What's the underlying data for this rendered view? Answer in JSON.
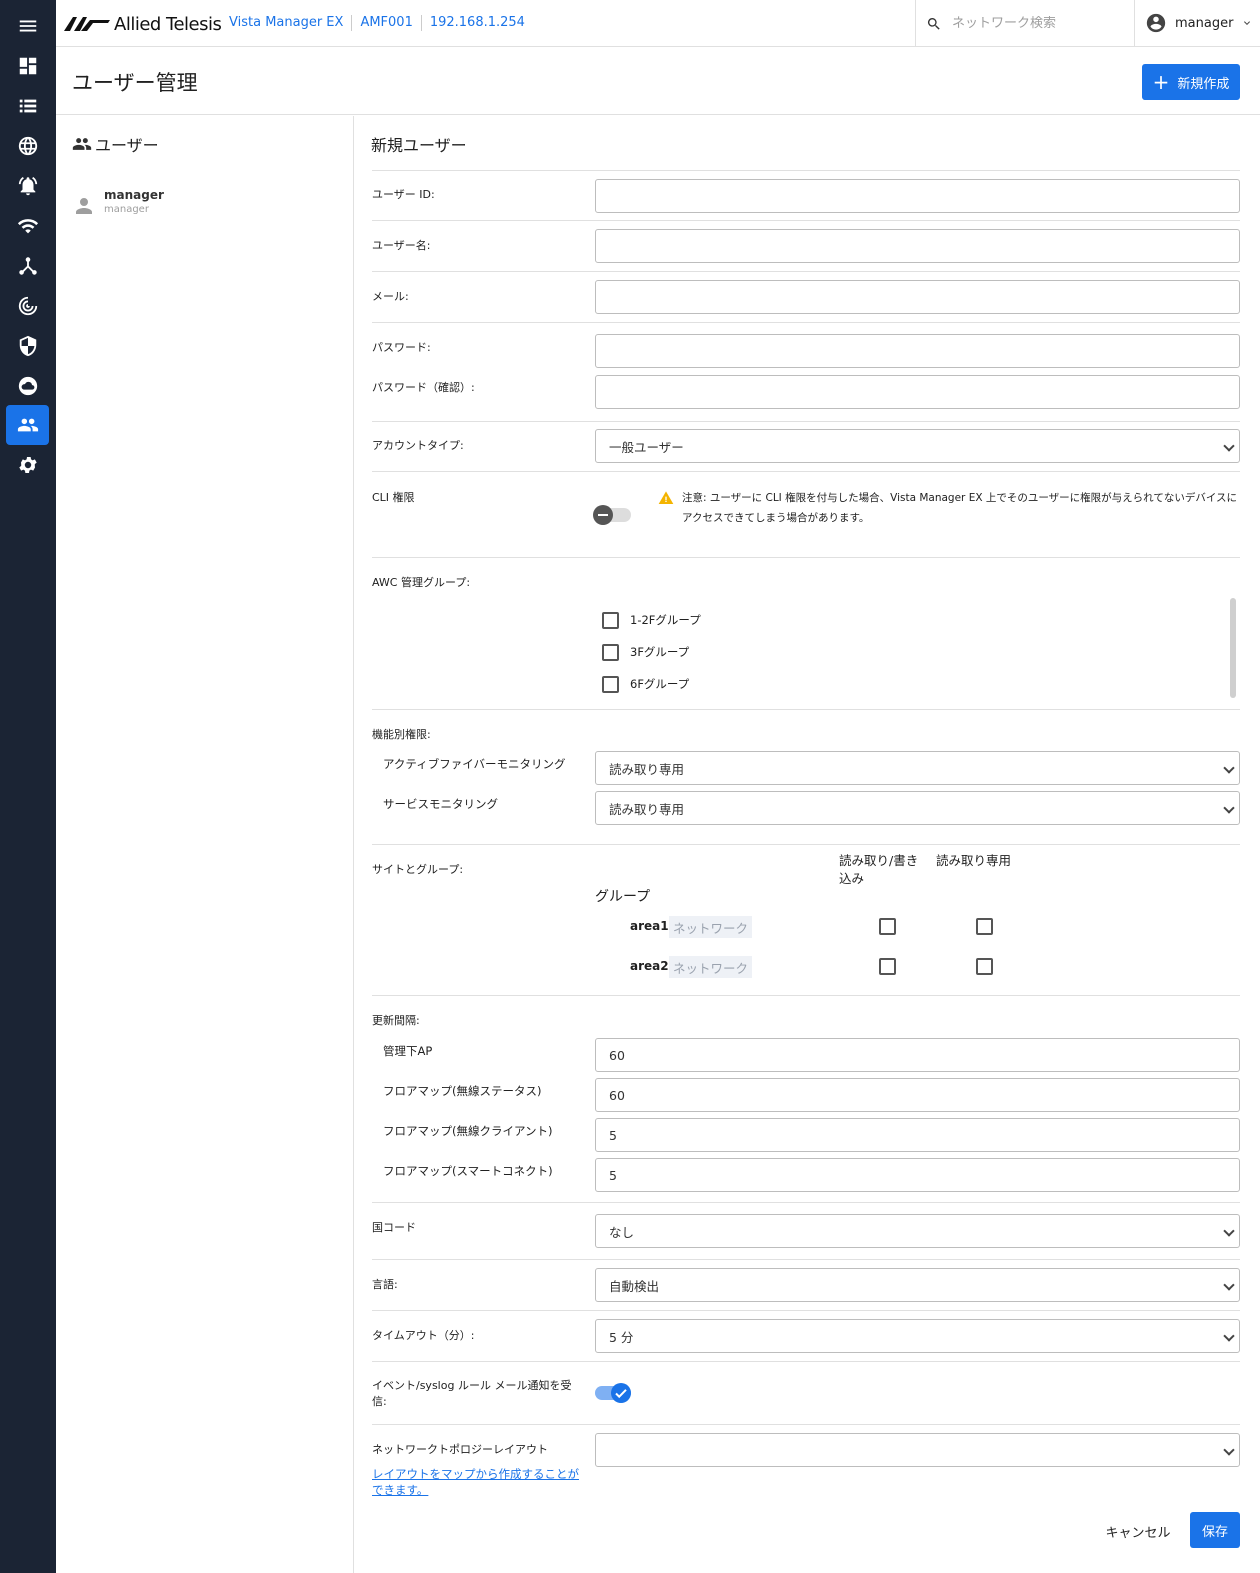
{
  "nav": {
    "items": [
      {
        "icon": "menu-icon"
      },
      {
        "icon": "dashboard-icon"
      },
      {
        "icon": "list-icon"
      },
      {
        "icon": "globe-icon"
      },
      {
        "icon": "alarm-icon"
      },
      {
        "icon": "wifi-icon"
      },
      {
        "icon": "topology-icon"
      },
      {
        "icon": "radar-icon"
      },
      {
        "icon": "shield-icon"
      },
      {
        "icon": "cloud-icon"
      },
      {
        "icon": "users-icon",
        "active": true
      },
      {
        "icon": "settings-icon"
      }
    ]
  },
  "header": {
    "brand": "Allied Telesis",
    "breadcrumbs": [
      "Vista Manager EX",
      "AMF001",
      "192.168.1.254"
    ],
    "search_placeholder": "ネットワーク検索",
    "user": "manager"
  },
  "page": {
    "title": "ユーザー管理",
    "new_button": "新規作成"
  },
  "user_list": {
    "title": "ユーザー",
    "users": [
      {
        "name": "manager",
        "id": "manager"
      }
    ]
  },
  "form": {
    "title": "新規ユーザー",
    "user_id_label": "ユーザー ID:",
    "user_name_label": "ユーザー名:",
    "email_label": "メール:",
    "password_label": "パスワード:",
    "password_confirm_label": "パスワード（確認）:",
    "account_type_label": "アカウントタイプ:",
    "account_type_value": "一般ユーザー",
    "cli_label": "CLI 権限",
    "cli_enabled": false,
    "cli_warning": "注意: ユーザーに CLI 権限を付与した場合、Vista Manager EX 上でそのユーザーに権限が与えられてないデバイスにアクセスできてしまう場合があります。",
    "awc_label": "AWC 管理グループ:",
    "awc_groups": [
      {
        "label": "1-2Fグループ",
        "checked": false
      },
      {
        "label": "3Fグループ",
        "checked": false
      },
      {
        "label": "6Fグループ",
        "checked": false
      }
    ],
    "feature_label": "機能別権限:",
    "features": [
      {
        "label": "アクティブファイバーモニタリング",
        "value": "読み取り専用"
      },
      {
        "label": "サービスモニタリング",
        "value": "読み取り専用"
      }
    ],
    "sites_label": "サイトとグループ:",
    "col_rw": "読み取り/書き込み",
    "col_ro": "読み取り専用",
    "group_header": "グループ",
    "groups": [
      {
        "name": "area1",
        "tag": "ネットワーク",
        "rw": false,
        "ro": false
      },
      {
        "name": "area2",
        "tag": "ネットワーク",
        "rw": false,
        "ro": false
      }
    ],
    "refresh_label": "更新間隔:",
    "refresh": [
      {
        "label": "管理下AP",
        "value": "60"
      },
      {
        "label": "フロアマップ(無線ステータス)",
        "value": "60"
      },
      {
        "label": "フロアマップ(無線クライアント)",
        "value": "5"
      },
      {
        "label": "フロアマップ(スマートコネクト)",
        "value": "5"
      }
    ],
    "country_label": "国コード",
    "country_value": "なし",
    "language_label": "言語:",
    "language_value": "自動検出",
    "timeout_label": "タイムアウト（分）:",
    "timeout_value": "5 分",
    "event_label": "イベント/syslog ルール メール通知を受信:",
    "event_enabled": true,
    "topology_label": "ネットワークトポロジーレイアウト",
    "topology_value": "",
    "topology_link": "レイアウトをマップから作成することができます。",
    "cancel": "キャンセル",
    "save": "保存"
  },
  "colors": {
    "accent": "#1a73e8",
    "rail": "#1b2434",
    "warning": "#f4b400"
  }
}
